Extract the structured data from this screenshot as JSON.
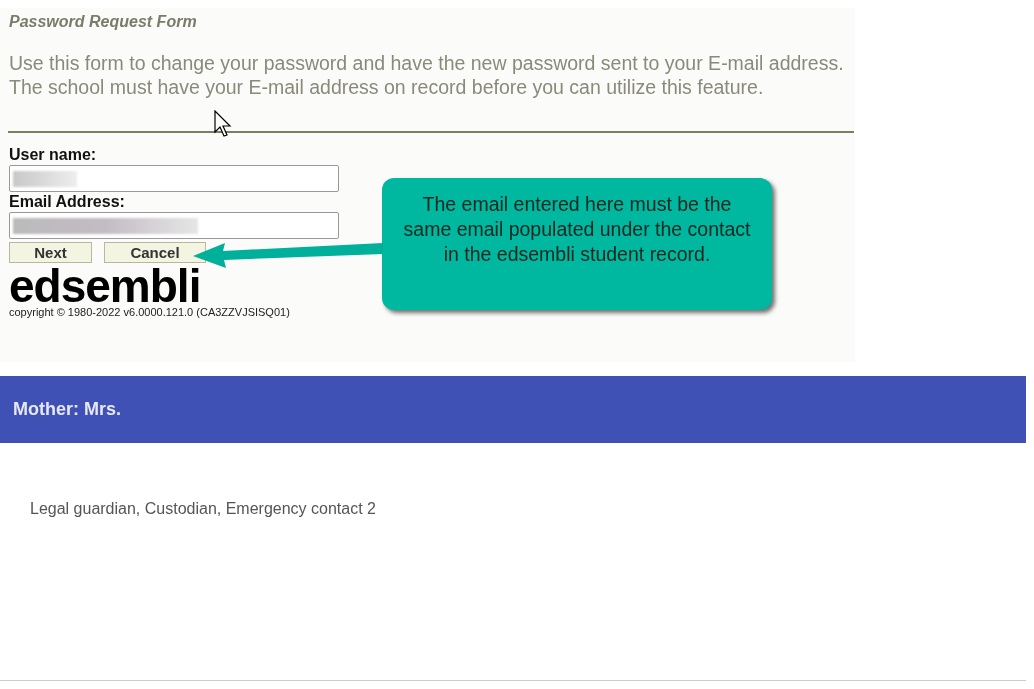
{
  "form": {
    "title": "Password Request Form",
    "intro": "Use this form to change your password and have the new password sent to your E-mail address. The school must have your E-mail address on record before you can utilize this feature.",
    "fields": [
      {
        "label": "User name:",
        "redacted": true
      },
      {
        "label": "Email Address:",
        "redacted": true
      }
    ],
    "buttons": [
      "Next",
      "Cancel"
    ],
    "logo": "edsembli",
    "copyright": "copyright © 1980-2022 v6.0000.121.0 (CA3ZZVJSISQ01)"
  },
  "callout": {
    "text": "The email entered here must be the same email populated under the contact in the edsembli student record."
  },
  "contact": {
    "header": "Mother: Mrs.",
    "roles": "Legal guardian, Custodian, Emergency contact 2"
  }
}
